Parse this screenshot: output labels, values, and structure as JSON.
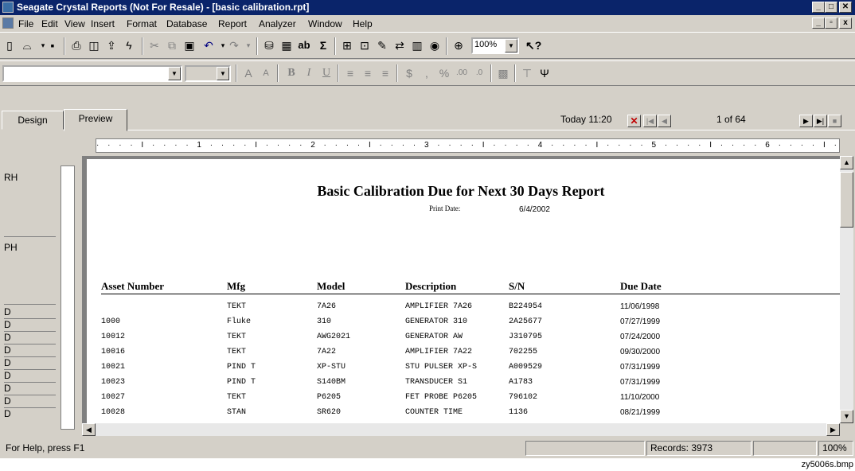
{
  "window": {
    "title": "Seagate Crystal Reports (Not For Resale) - [basic calibration.rpt]",
    "minimize": "_",
    "maximize": "□",
    "close": "✕"
  },
  "menu": {
    "items": [
      "File",
      "Edit",
      "View",
      "Insert",
      "Format",
      "Database",
      "Report",
      "Analyzer",
      "Window",
      "Help"
    ]
  },
  "toolbar": {
    "zoom": "100%",
    "font_name": "",
    "font_size": ""
  },
  "tabs": {
    "design": "Design",
    "preview": "Preview"
  },
  "nav": {
    "today": "Today 11:20",
    "page": "1 of 64"
  },
  "ruler": "· · · · I · · · · 1 · · · · I · · · · 2 · · · · I · · · · 3 · · · · I · · · · 4 · · · · I · · · · 5 · · · · I · · · · 6 · · · · I · · · · 7 · · · · I ·",
  "sections": {
    "rh": "RH",
    "ph": "PH",
    "d": "D"
  },
  "report": {
    "title": "Basic Calibration Due for Next 30 Days Report",
    "print_date_label": "Print Date:",
    "print_date": "6/4/2002",
    "columns": [
      "Asset Number",
      "Mfg",
      "Model",
      "Description",
      "S/N",
      "Due Date"
    ],
    "rows": [
      [
        "",
        "TEKT",
        "7A26",
        "AMPLIFIER 7A26",
        "B224954",
        "11/06/1998"
      ],
      [
        "1000",
        "Fluke",
        "310",
        "GENERATOR 310",
        "2A25677",
        "07/27/1999"
      ],
      [
        "10012",
        "TEKT",
        "AWG2021",
        "GENERATOR AW",
        "J310795",
        "07/24/2000"
      ],
      [
        "10016",
        "TEKT",
        "7A22",
        "AMPLIFIER 7A22",
        "702255",
        "09/30/2000"
      ],
      [
        "10021",
        "PIND T",
        "XP-STU",
        "STU PULSER XP-S",
        "A009529",
        "07/31/1999"
      ],
      [
        "10023",
        "PIND T",
        "S140BM",
        "TRANSDUCER S1",
        "A1783",
        "07/31/1999"
      ],
      [
        "10027",
        "TEKT",
        "P6205",
        "FET PROBE P6205",
        "796102",
        "11/10/2000"
      ],
      [
        "10028",
        "STAN",
        "SR620",
        "COUNTER TIME",
        "1136",
        "08/21/1999"
      ]
    ]
  },
  "status": {
    "help": "For Help, press F1",
    "records": "Records: 3973",
    "zoom": "100%"
  },
  "caption": "zy5006s.bmp"
}
